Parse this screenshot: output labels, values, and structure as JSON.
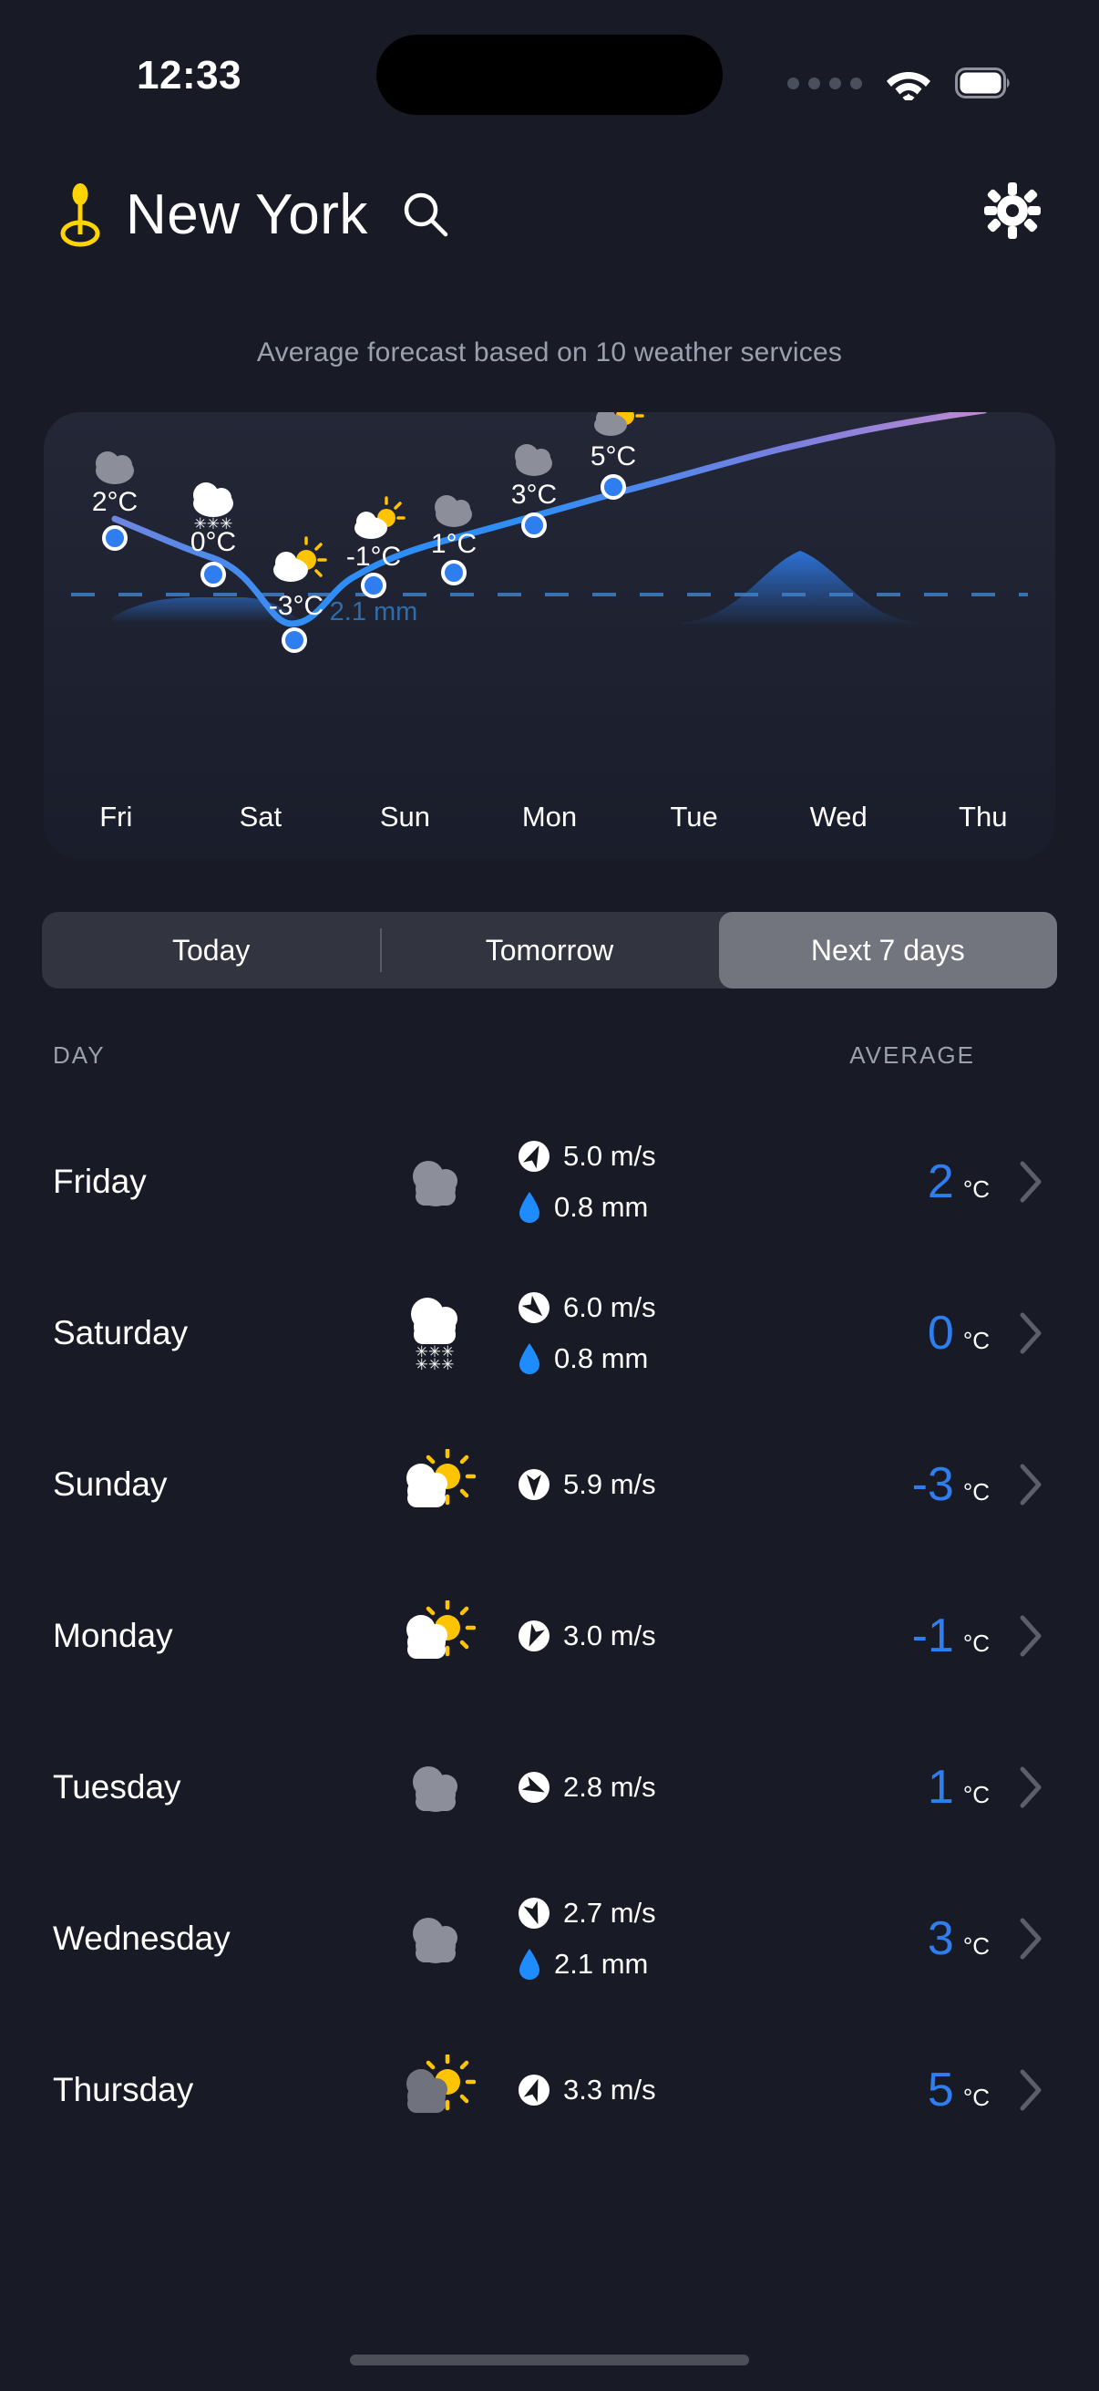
{
  "status_bar": {
    "time": "12:33",
    "cellular_icon": "cellular-dots-icon",
    "wifi_icon": "wifi-icon",
    "battery_icon": "battery-full-icon"
  },
  "header": {
    "location_pin_icon": "map-pin-icon",
    "city": "New York",
    "search_icon": "search-icon",
    "settings_icon": "gear-icon"
  },
  "subtitle": "Average forecast based on 10 weather services",
  "chart_data": {
    "type": "line",
    "title": "",
    "xlabel": "",
    "ylabel": "",
    "categories": [
      "Fri",
      "Sat",
      "Sun",
      "Mon",
      "Tue",
      "Wed",
      "Thu"
    ],
    "values": [
      2,
      0,
      -3,
      -1,
      1,
      3,
      5
    ],
    "point_labels": [
      "2°C",
      "0°C",
      "-3°C",
      "-1°C",
      "1°C",
      "3°C",
      "5°C"
    ],
    "condition_icons": [
      "cloud",
      "snow",
      "partly-sunny",
      "partly-sunny",
      "cloud",
      "cloud",
      "partly-sunny-gray"
    ],
    "precipitation_label": "2.1 mm",
    "freezing_line": 0,
    "ylim": [
      -4,
      6
    ],
    "grid": false,
    "legend": "none",
    "line_color_start": "#2f8ef5",
    "line_color_end": "#b08ad8",
    "point_fill": "#2f7ef0",
    "point_stroke": "#ffffff"
  },
  "tabs": [
    {
      "label": "Today",
      "active": false
    },
    {
      "label": "Tomorrow",
      "active": false
    },
    {
      "label": "Next 7 days",
      "active": true
    }
  ],
  "list": {
    "col_day": "DAY",
    "col_average": "AVERAGE",
    "rows": [
      {
        "day": "Friday",
        "icon": "cloud",
        "wind": "5.0 m/s",
        "wind_dir_deg": 25,
        "precip": "0.8 mm",
        "temp": "2",
        "unit": "°C"
      },
      {
        "day": "Saturday",
        "icon": "snow",
        "wind": "6.0 m/s",
        "wind_dir_deg": 135,
        "precip": "0.8 mm",
        "temp": "0",
        "unit": "°C"
      },
      {
        "day": "Sunday",
        "icon": "partly-sunny",
        "wind": "5.9 m/s",
        "wind_dir_deg": 180,
        "precip": "",
        "temp": "-3",
        "unit": "°C"
      },
      {
        "day": "Monday",
        "icon": "partly-sunny",
        "wind": "3.0 m/s",
        "wind_dir_deg": 205,
        "precip": "",
        "temp": "-1",
        "unit": "°C"
      },
      {
        "day": "Tuesday",
        "icon": "cloud",
        "wind": "2.8 m/s",
        "wind_dir_deg": 115,
        "precip": "",
        "temp": "1",
        "unit": "°C"
      },
      {
        "day": "Wednesday",
        "icon": "cloud",
        "wind": "2.7 m/s",
        "wind_dir_deg": 160,
        "precip": "2.1 mm",
        "temp": "3",
        "unit": "°C"
      },
      {
        "day": "Thursday",
        "icon": "partly-sunny-gray",
        "wind": "3.3 m/s",
        "wind_dir_deg": 20,
        "precip": "",
        "temp": "5",
        "unit": "°C"
      }
    ],
    "chevron_icon": "chevron-right-icon",
    "wind_icon": "wind-direction-icon",
    "precip_icon": "water-drop-icon"
  },
  "colors": {
    "background": "#181b25",
    "card": "#232736",
    "accent_blue": "#2f7ef0",
    "pin_yellow": "#ffd400",
    "muted_text": "#9ba0ad"
  }
}
